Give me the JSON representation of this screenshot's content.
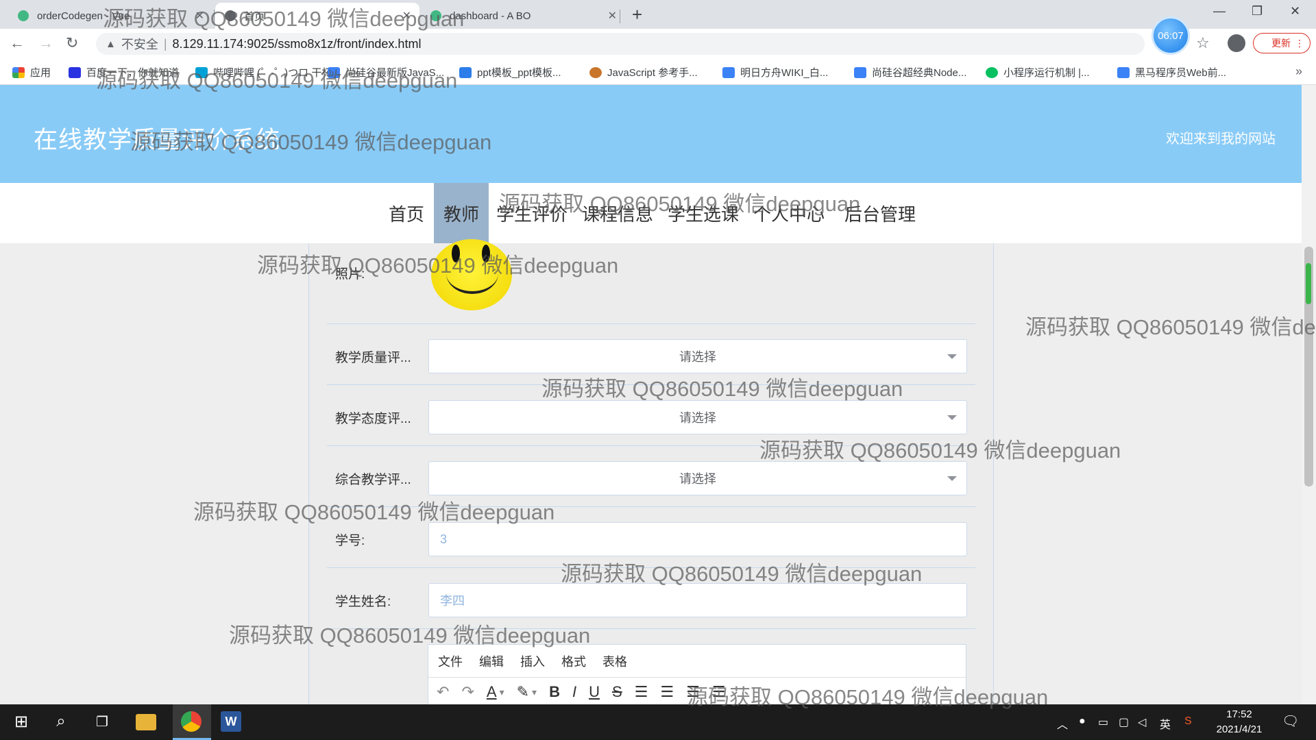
{
  "browser": {
    "tabs": [
      {
        "label": "orderCodegen - Vue",
        "color": "#41b883"
      },
      {
        "label": "首页",
        "color": "#5f6368"
      },
      {
        "label": "dashboard - A BO",
        "color": "#41b883"
      }
    ],
    "window_controls": [
      "minimize",
      "restore",
      "close"
    ],
    "url_warning": "不安全",
    "url": "8.129.11.174:9025/ssmo8x1z/front/index.html",
    "clock_badge": "06:07",
    "update_label": "更新",
    "bookmarks": [
      "应用",
      "百度一下，你就知道",
      "哔哩哔哩 (゜-゜)つロ 干杯~",
      "尚硅谷最新版JavaS...",
      "ppt模板_ppt模板...",
      "JavaScript 参考手...",
      "明日方舟WIKI_白...",
      "尚硅谷超经典Node...",
      "小程序运行机制 |...",
      "黑马程序员Web前..."
    ],
    "bookmark_more": "»"
  },
  "site": {
    "title": "在线教学质量评价系统",
    "welcome": "欢迎来到我的网站",
    "nav": [
      "首页",
      "教师",
      "学生评价",
      "课程信息",
      "学生选课",
      "个人中心",
      "后台管理"
    ],
    "active_nav": "教师"
  },
  "form": {
    "photo_label": "照片:",
    "fields": [
      {
        "label": "教学质量评...",
        "type": "select",
        "placeholder": "请选择"
      },
      {
        "label": "教学态度评...",
        "type": "select",
        "placeholder": "请选择"
      },
      {
        "label": "综合教学评...",
        "type": "select",
        "placeholder": "请选择"
      },
      {
        "label": "学号:",
        "type": "input",
        "value": "3"
      },
      {
        "label": "学生姓名:",
        "type": "input",
        "value": "李四"
      }
    ],
    "editor_menu": [
      "文件",
      "编辑",
      "插入",
      "格式",
      "表格"
    ],
    "editor_tools": [
      "undo-icon",
      "redo-icon",
      "text-color-icon",
      "highlight-icon",
      "bold-icon",
      "italic-icon",
      "underline-icon",
      "strikethrough-icon",
      "align-left-icon",
      "align-center-icon",
      "align-right-icon",
      "justify-icon"
    ]
  },
  "watermark": "源码获取 QQ86050149 微信deepguan",
  "watermark_partial": "源码获取 QQ86050149 微信de",
  "taskbar": {
    "time": "17:52",
    "date": "2021/4/21",
    "ime": "英"
  }
}
